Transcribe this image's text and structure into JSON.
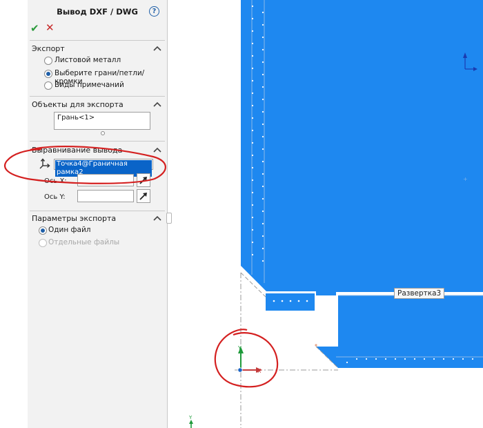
{
  "panel": {
    "title": "Вывод DXF / DWG",
    "help_label": "?",
    "ok_glyph": "✔",
    "cancel_glyph": "✕"
  },
  "export": {
    "header": "Экспорт",
    "options": [
      "Листовой металл",
      "Выберите грани/петли/кромки",
      "Виды примечаний"
    ],
    "selected": 1
  },
  "objects": {
    "header": "Объекты для экспорта",
    "items": [
      "Грань<1>"
    ]
  },
  "alignment": {
    "header": "Выравнивание вывода",
    "origin_value": "Точка4@Граничная рамка2",
    "x_label": "Ось X:",
    "x_value": "",
    "y_label": "Ось Y:",
    "y_value": ""
  },
  "params": {
    "header": "Параметры экспорта",
    "options": [
      "Один файл",
      "Отдельные файлы"
    ],
    "selected": 0,
    "disabled": [
      1
    ]
  },
  "viewport": {
    "flat_pattern_tag": "Развертка3",
    "axis_x_label": "X",
    "axis_y_label": "Y",
    "part_color": "#1e88f0",
    "annotation_color": "#d42020"
  }
}
